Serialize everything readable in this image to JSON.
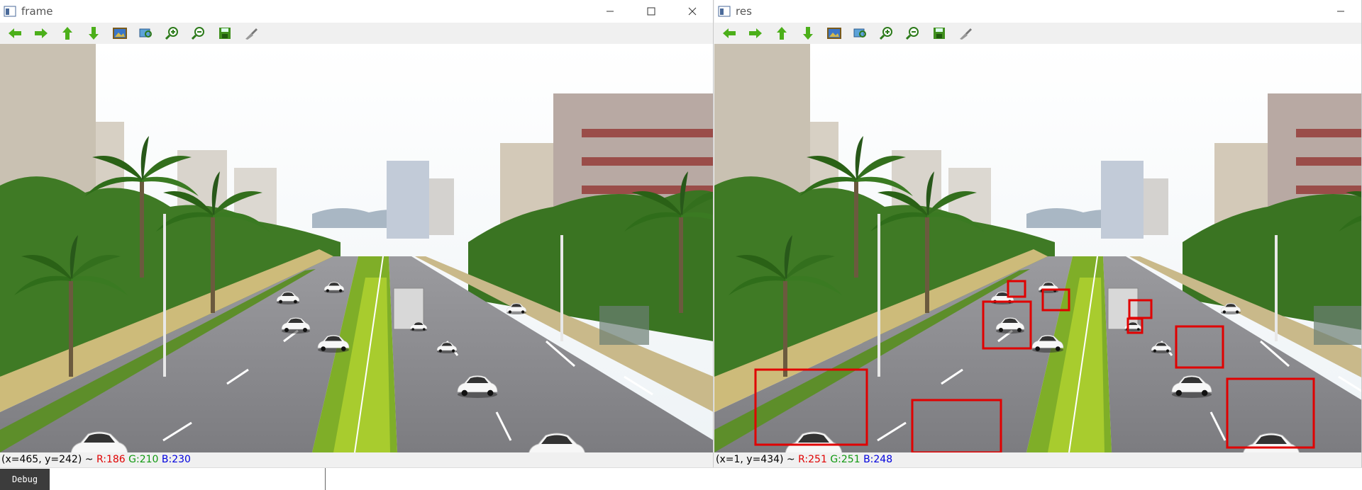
{
  "windows": [
    {
      "id": "frame",
      "title": "frame",
      "controls": [
        "minimize-icon",
        "maximize-icon",
        "close-icon"
      ],
      "status": {
        "coords": "(x=465, y=242) ~ ",
        "r": "R:186",
        "g": "G:210",
        "b": "B:230"
      }
    },
    {
      "id": "res",
      "title": "res",
      "controls": [
        "minimize-icon"
      ],
      "status": {
        "coords": "(x=1, y=434) ~ ",
        "r": "R:251",
        "g": "G:251",
        "b": "B:248"
      }
    }
  ],
  "toolbar": [
    {
      "name": "pan-left-icon"
    },
    {
      "name": "pan-right-icon"
    },
    {
      "name": "pan-up-icon"
    },
    {
      "name": "pan-down-icon"
    },
    {
      "name": "zoom-image-icon"
    },
    {
      "name": "zoom-fit-icon"
    },
    {
      "name": "zoom-in-icon"
    },
    {
      "name": "zoom-out-icon"
    },
    {
      "name": "save-icon"
    },
    {
      "name": "properties-icon"
    }
  ],
  "detection_box_color": "#e00000",
  "bottom": {
    "debug_label": "Debug"
  }
}
